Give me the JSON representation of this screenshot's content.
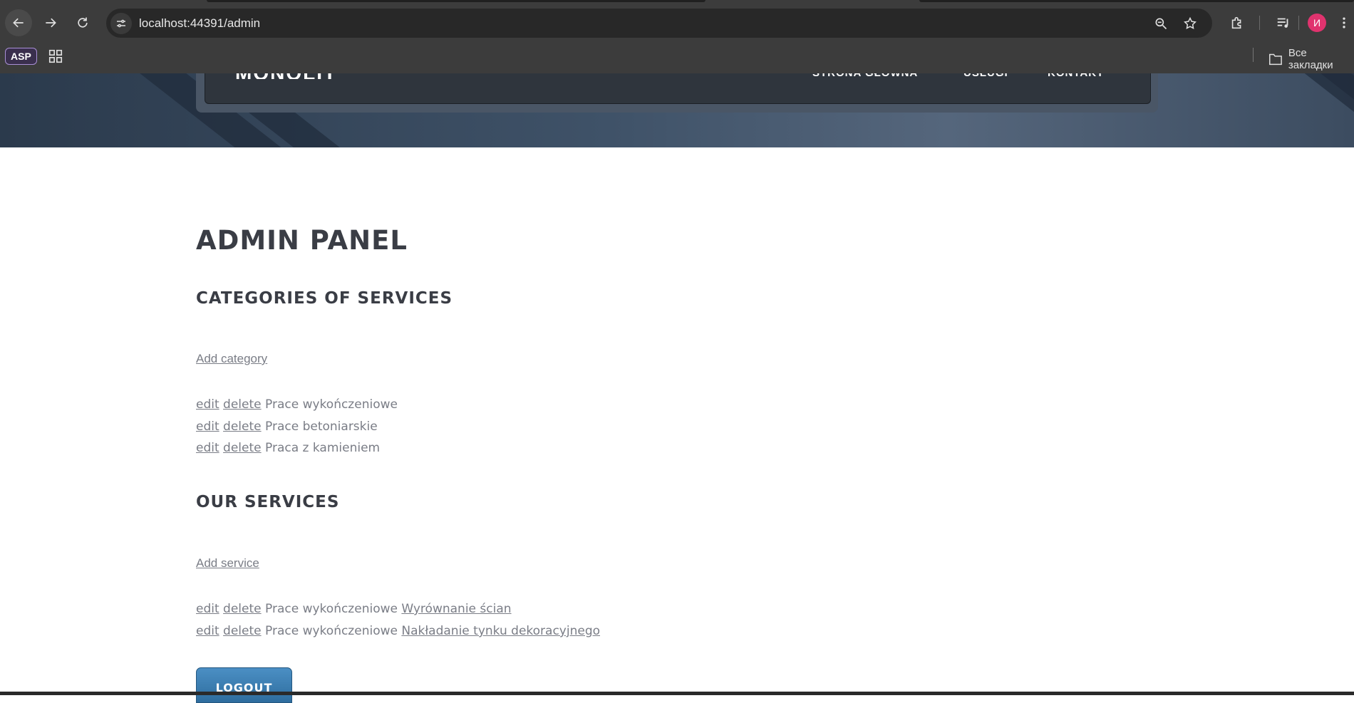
{
  "browser": {
    "url": "localhost:44391/admin",
    "avatar_letter": "И",
    "bookmarks": {
      "asp_label": "ASP",
      "folder_label": "Все закладки"
    }
  },
  "site": {
    "logo": "MONOLIT",
    "nav": [
      "STRONA GŁÓWNA",
      "USŁUGI",
      "KONTAKT"
    ]
  },
  "page": {
    "title": "ADMIN PANEL",
    "categories": {
      "heading": "CATEGORIES OF SERVICES",
      "add_label": "Add category",
      "items": [
        {
          "edit": "edit",
          "delete": "delete",
          "name": "Prace wykończeniowe"
        },
        {
          "edit": "edit",
          "delete": "delete",
          "name": "Prace betoniarskie"
        },
        {
          "edit": "edit",
          "delete": "delete",
          "name": "Praca z kamieniem"
        }
      ]
    },
    "services": {
      "heading": "OUR SERVICES",
      "add_label": "Add service",
      "items": [
        {
          "edit": "edit",
          "delete": "delete",
          "category": "Prace wykończeniowe",
          "name": "Wyrównanie ścian"
        },
        {
          "edit": "edit",
          "delete": "delete",
          "category": "Prace wykończeniowe",
          "name": "Nakładanie tynku dekoracyjnego"
        }
      ]
    },
    "logout_label": "LOGOUT"
  },
  "colors": {
    "chrome": "#3c3c3c",
    "omnibox": "#282828",
    "heading": "#3a3d45",
    "link": "#7a7d86",
    "button": "#2e6d9e",
    "avatar": "#e0336e"
  }
}
